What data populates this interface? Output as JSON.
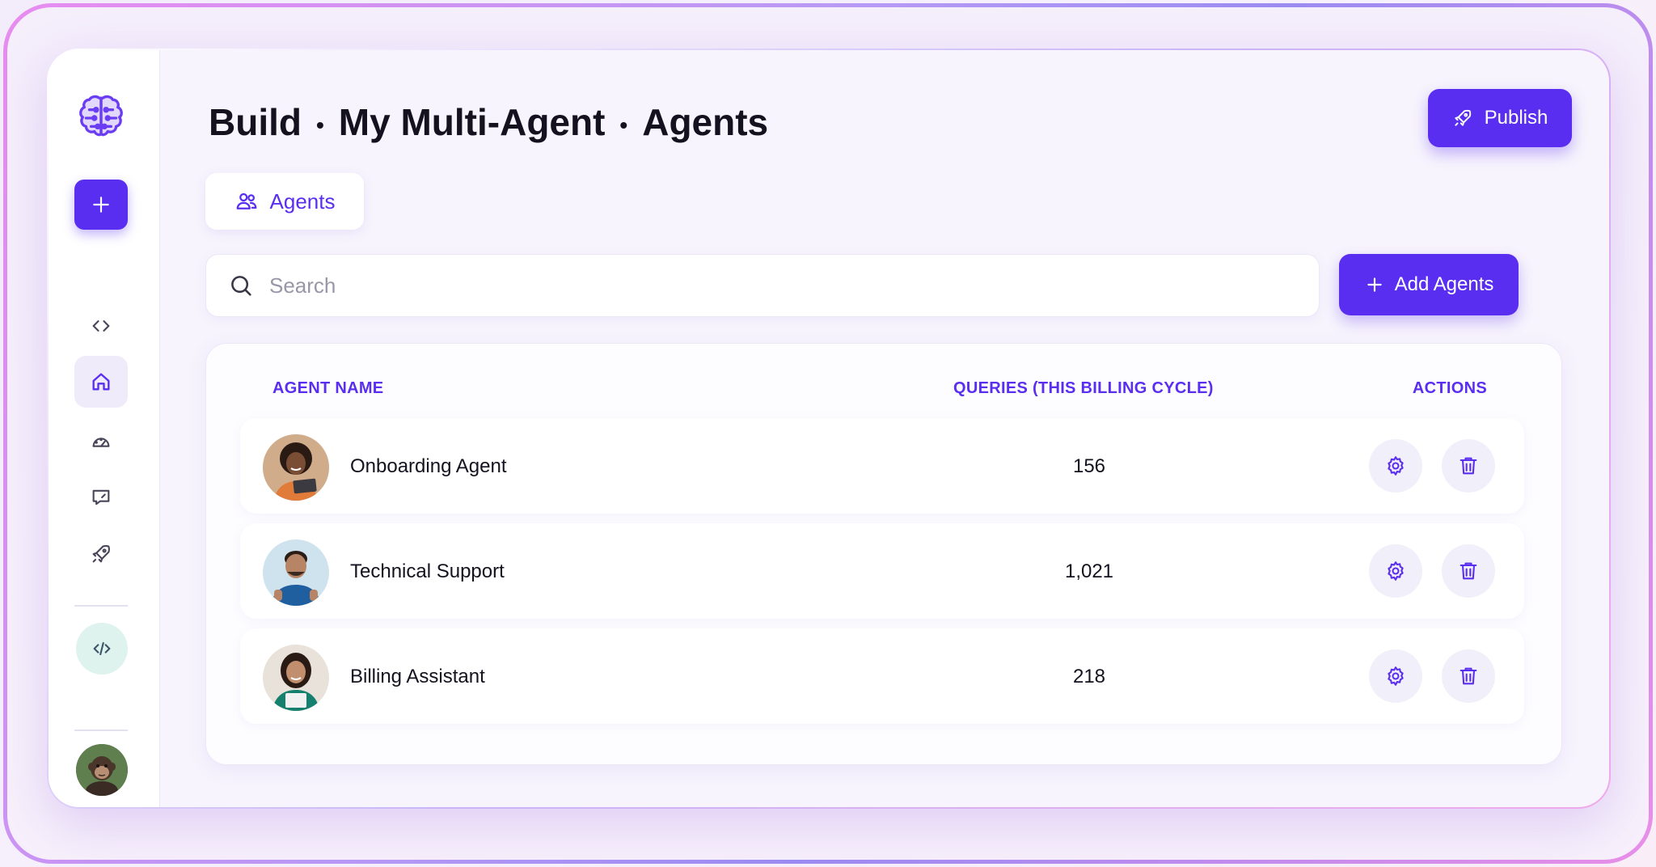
{
  "sidebar": {
    "logo_icon": "brain-circuit-icon",
    "items": [
      {
        "name": "create",
        "icon": "plus-icon"
      },
      {
        "name": "code",
        "icon": "code-brackets-icon"
      },
      {
        "name": "home",
        "icon": "home-icon",
        "active": true
      },
      {
        "name": "analytics",
        "icon": "gauge-icon"
      },
      {
        "name": "chat",
        "icon": "chat-icon"
      },
      {
        "name": "deploy",
        "icon": "rocket-icon"
      },
      {
        "name": "embed",
        "icon": "code-slash-icon"
      }
    ]
  },
  "header": {
    "breadcrumb": [
      "Build",
      "My Multi-Agent",
      "Agents"
    ],
    "separator": "•",
    "publish_label": "Publish"
  },
  "tabs": [
    {
      "label": "Agents",
      "icon": "users-icon",
      "active": true
    }
  ],
  "search": {
    "placeholder": "Search",
    "value": ""
  },
  "add_button_label": "Add Agents",
  "table": {
    "columns": [
      "AGENT NAME",
      "QUERIES (THIS BILLING CYCLE)",
      "ACTIONS"
    ],
    "rows": [
      {
        "name": "Onboarding Agent",
        "queries": "156"
      },
      {
        "name": "Technical Support",
        "queries": "1,021"
      },
      {
        "name": "Billing Assistant",
        "queries": "218"
      }
    ]
  },
  "colors": {
    "accent": "#5a2ef0",
    "action_bg": "#f1eff9",
    "embed_bg": "#dff3ee"
  }
}
